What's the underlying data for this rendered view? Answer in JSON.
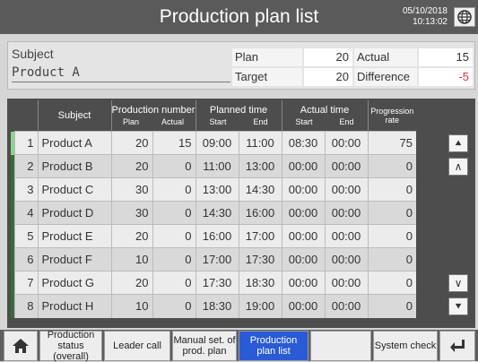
{
  "header": {
    "title": "Production plan list",
    "date": "05/10/2018",
    "time": "10:13:02",
    "globe_icon": "globe-icon"
  },
  "info": {
    "subject_label": "Subject",
    "subject_value": "Product A",
    "plan_label": "Plan",
    "plan_value": "20",
    "target_label": "Target",
    "target_value": "20",
    "actual_label": "Actual",
    "actual_value": "15",
    "difference_label": "Difference",
    "difference_value": "-5"
  },
  "table": {
    "headers": {
      "subject": "Subject",
      "production_number": "Production number",
      "plan": "Plan",
      "actual": "Actual",
      "planned_time": "Planned time",
      "start": "Start",
      "end": "End",
      "actual_time": "Actual time",
      "actual_start": "Start",
      "actual_end": "End",
      "progression": "Progression rate"
    },
    "rows": [
      {
        "no": "1",
        "subject": "Product A",
        "plan": "20",
        "actual": "15",
        "p_start": "09:00",
        "p_end": "11:00",
        "a_start": "08:30",
        "a_end": "00:00",
        "rate": "75"
      },
      {
        "no": "2",
        "subject": "Product B",
        "plan": "20",
        "actual": "0",
        "p_start": "11:00",
        "p_end": "13:00",
        "a_start": "00:00",
        "a_end": "00:00",
        "rate": "0"
      },
      {
        "no": "3",
        "subject": "Product C",
        "plan": "30",
        "actual": "0",
        "p_start": "13:00",
        "p_end": "14:30",
        "a_start": "00:00",
        "a_end": "00:00",
        "rate": "0"
      },
      {
        "no": "4",
        "subject": "Product D",
        "plan": "30",
        "actual": "0",
        "p_start": "14:30",
        "p_end": "16:00",
        "a_start": "00:00",
        "a_end": "00:00",
        "rate": "0"
      },
      {
        "no": "5",
        "subject": "Product E",
        "plan": "20",
        "actual": "0",
        "p_start": "16:00",
        "p_end": "17:00",
        "a_start": "00:00",
        "a_end": "00:00",
        "rate": "0"
      },
      {
        "no": "6",
        "subject": "Product F",
        "plan": "10",
        "actual": "0",
        "p_start": "17:00",
        "p_end": "17:30",
        "a_start": "00:00",
        "a_end": "00:00",
        "rate": "0"
      },
      {
        "no": "7",
        "subject": "Product G",
        "plan": "20",
        "actual": "0",
        "p_start": "17:30",
        "p_end": "18:30",
        "a_start": "00:00",
        "a_end": "00:00",
        "rate": "0"
      },
      {
        "no": "8",
        "subject": "Product H",
        "plan": "10",
        "actual": "0",
        "p_start": "18:30",
        "p_end": "19:00",
        "a_start": "00:00",
        "a_end": "00:00",
        "rate": "0"
      }
    ]
  },
  "scroll": {
    "top_icon": "double-chevron-up-icon",
    "up_icon": "chevron-up-icon",
    "down_icon": "chevron-down-icon",
    "bottom_icon": "double-chevron-down-icon"
  },
  "footer": {
    "home_icon": "home-icon",
    "buttons": [
      "Production status (overall)",
      "Leader call",
      "Manual set. of prod. plan",
      "Production plan list",
      "",
      "System check"
    ],
    "return_icon": "return-icon",
    "active_index": 3,
    "active_color": "#2a5bd7"
  }
}
